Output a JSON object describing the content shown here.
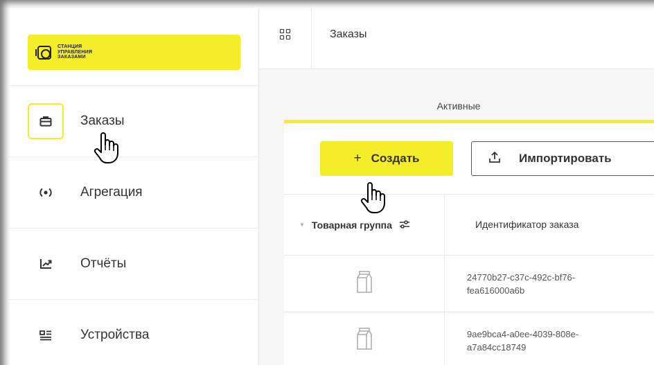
{
  "logo": {
    "text": "СТАНЦИЯ\nУПРАВЛЕНИЯ\nЗАКАЗАМИ"
  },
  "sidebar": {
    "items": [
      {
        "label": "Заказы",
        "icon": "briefcase-icon",
        "active": true
      },
      {
        "label": "Агрегация",
        "icon": "aggregation-icon",
        "active": false
      },
      {
        "label": "Отчёты",
        "icon": "chart-trend-icon",
        "active": false
      },
      {
        "label": "Устройства",
        "icon": "devices-icon",
        "active": false
      }
    ]
  },
  "topbar": {
    "title": "Заказы",
    "icon": "apps-grid-icon"
  },
  "tabs": {
    "active_label": "Активные"
  },
  "toolbar": {
    "create_label": "Создать",
    "create_plus": "+",
    "import_label": "Импортировать"
  },
  "table": {
    "columns": [
      "Товарная группа",
      "Идентификатор заказа"
    ],
    "rows": [
      {
        "group_icon": "milk-carton-icon",
        "id_line1": "24770b27-c37c-492c-bf76-",
        "id_line2": "fea616000a6b"
      },
      {
        "group_icon": "milk-carton-icon",
        "id_line1": "9ae9bca4-a0ee-4039-808e-",
        "id_line2": "a7a84cc18749"
      }
    ]
  },
  "colors": {
    "accent": "#f4ee2a",
    "text": "#333333"
  }
}
